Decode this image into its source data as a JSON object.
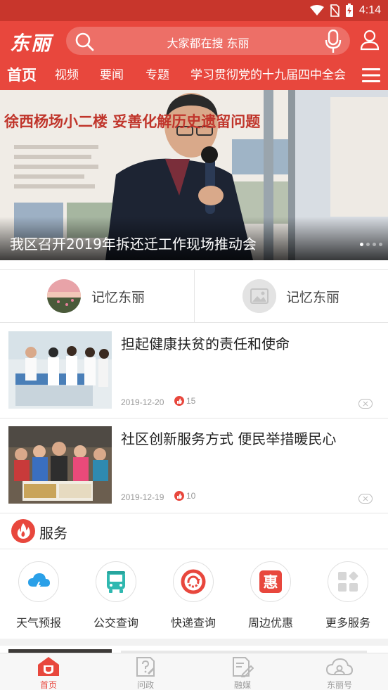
{
  "status_bar": {
    "time": "4:14"
  },
  "header": {
    "logo": "东丽",
    "search_placeholder": "大家都在搜 东丽"
  },
  "tabs": [
    {
      "label": "首页",
      "active": true
    },
    {
      "label": "视频"
    },
    {
      "label": "要闻"
    },
    {
      "label": "专题"
    },
    {
      "label": "学习贯彻党的十九届四中全会"
    }
  ],
  "banner": {
    "caption": "我区召开2019年拆还迁工作现场推动会",
    "photo_text": "徐西杨场小二楼 妥善化解历史遗留问题",
    "slide_count": 4,
    "active_slide": 1
  },
  "entries": [
    {
      "label": "记忆东丽"
    },
    {
      "label": "记忆东丽"
    }
  ],
  "news": [
    {
      "title": "担起健康扶贫的责任和使命",
      "date": "2019-12-20",
      "likes": "15"
    },
    {
      "title": "社区创新服务方式 便民举措暖民心",
      "date": "2019-12-19",
      "likes": "10"
    }
  ],
  "services": {
    "heading": "服务",
    "items": [
      {
        "label": "天气预报",
        "icon": "weather-icon"
      },
      {
        "label": "公交查询",
        "icon": "bus-icon"
      },
      {
        "label": "快递查询",
        "icon": "express-icon"
      },
      {
        "label": "周边优惠",
        "icon": "discount-icon"
      },
      {
        "label": "更多服务",
        "icon": "more-services-icon"
      }
    ]
  },
  "bottom_nav": [
    {
      "label": "首页",
      "active": true
    },
    {
      "label": "问政"
    },
    {
      "label": "融媒"
    },
    {
      "label": "东丽号"
    }
  ],
  "colors": {
    "brand_red": "#e8473d",
    "status_bar": "#c8362c"
  }
}
